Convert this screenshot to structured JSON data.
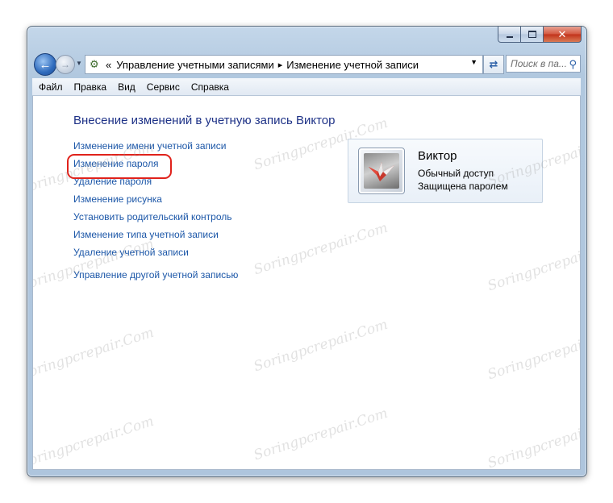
{
  "window": {
    "caption_buttons": {
      "minimize": "minimize-icon",
      "maximize": "maximize-icon",
      "close": "close-icon"
    }
  },
  "navigation": {
    "back_icon": "back-arrow-icon",
    "forward_icon": "forward-arrow-icon",
    "address": {
      "prefix": "«",
      "crumbs": [
        "Управление учетными записями",
        "Изменение учетной записи"
      ],
      "separator": "▸"
    },
    "search_placeholder": "Поиск в па..."
  },
  "menubar": [
    "Файл",
    "Правка",
    "Вид",
    "Сервис",
    "Справка"
  ],
  "main": {
    "title": "Внесение изменений в учетную запись Виктор",
    "links": [
      "Изменение имени учетной записи",
      "Изменение пароля",
      "Удаление пароля",
      "Изменение рисунка",
      "Установить родительский контроль",
      "Изменение типа учетной записи",
      "Удаление учетной записи",
      "Управление другой учетной записью"
    ],
    "highlighted_link_index": 1,
    "highlight_color": "#e0221b"
  },
  "user": {
    "name": "Виктор",
    "type": "Обычный доступ",
    "protection": "Защищена паролем",
    "avatar_icon": "origami-crane-icon"
  },
  "watermark": "Soringpcrepair.Com",
  "colors": {
    "link": "#1c57a8",
    "title": "#1e3287"
  }
}
